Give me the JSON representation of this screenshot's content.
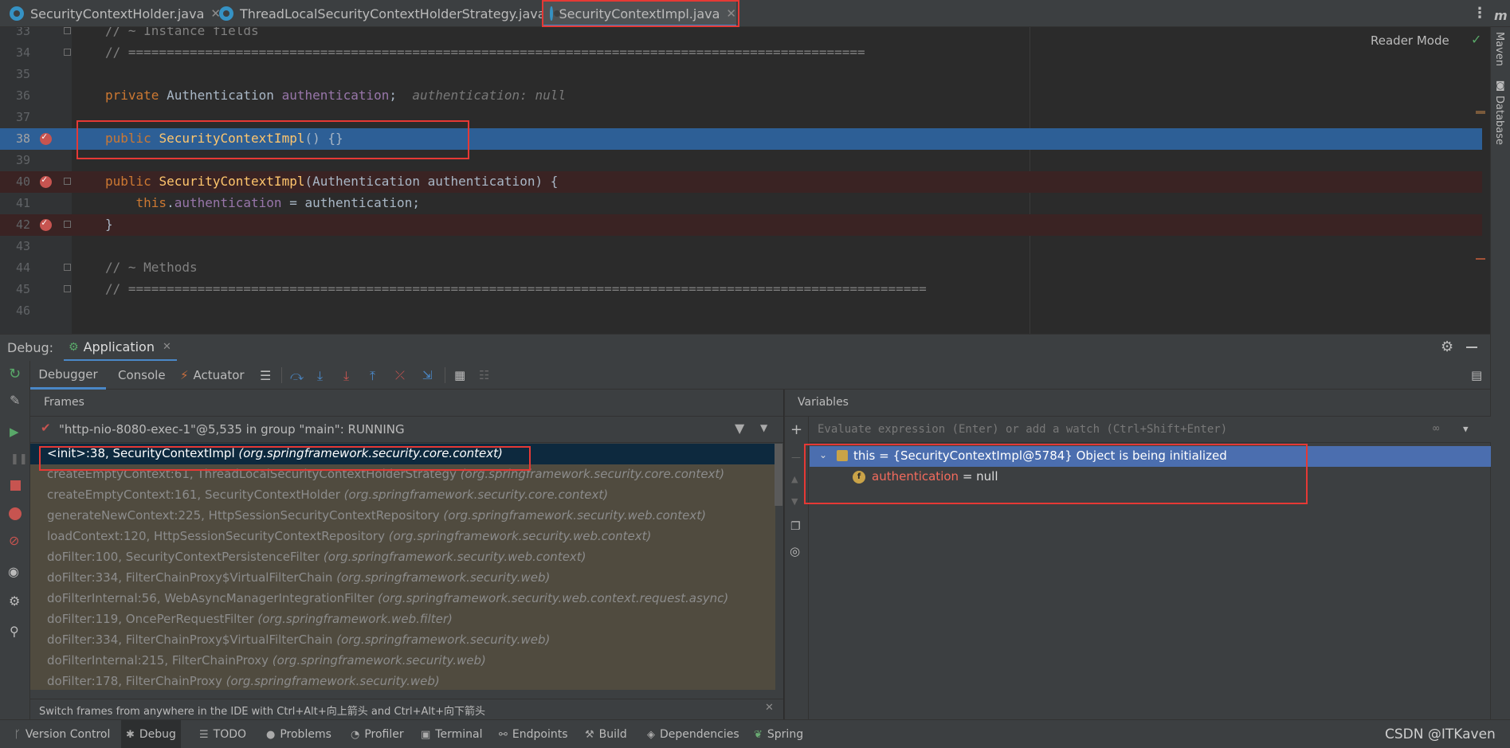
{
  "tabs": [
    {
      "label": "SecurityContextHolder.java"
    },
    {
      "label": "ThreadLocalSecurityContextHolderStrategy.java"
    },
    {
      "label": "SecurityContextImpl.java"
    }
  ],
  "editor": {
    "reader_mode": "Reader Mode",
    "lines": [
      {
        "n": "33",
        "text": "// ~ Instance fields"
      },
      {
        "n": "34",
        "text": "// ================================================================================================"
      },
      {
        "n": "35",
        "text": ""
      },
      {
        "n": "36",
        "kw": "private",
        "type": " Authentication ",
        "field": "authentication",
        "rest": ";",
        "hint": "authentication: null"
      },
      {
        "n": "37",
        "text": ""
      },
      {
        "n": "38",
        "kw": "public",
        "fn": "SecurityContextImpl",
        "rest": "() {}"
      },
      {
        "n": "39",
        "text": ""
      },
      {
        "n": "40",
        "kw": "public",
        "fn": "SecurityContextImpl",
        "rest": "(Authentication authentication) {"
      },
      {
        "n": "41",
        "kw": "this",
        "field": "authentication",
        "rest": " = authentication;"
      },
      {
        "n": "42",
        "text": "}"
      },
      {
        "n": "43",
        "text": ""
      },
      {
        "n": "44",
        "text": "// ~ Methods"
      },
      {
        "n": "45",
        "text": "// ========================================================================================================"
      },
      {
        "n": "46",
        "text": ""
      }
    ]
  },
  "debug": {
    "label": "Debug:",
    "config": "Application",
    "subtabs": [
      "Debugger",
      "Console",
      "Actuator"
    ],
    "frames_title": "Frames",
    "variables_title": "Variables",
    "thread": "\"http-nio-8080-exec-1\"@5,535 in group \"main\": RUNNING",
    "frames": [
      {
        "method": "<init>:38, SecurityContextImpl ",
        "pkg": "(org.springframework.security.core.context)"
      },
      {
        "method": "createEmptyContext:61, ThreadLocalSecurityContextHolderStrategy ",
        "pkg": "(org.springframework.security.core.context)"
      },
      {
        "method": "createEmptyContext:161, SecurityContextHolder ",
        "pkg": "(org.springframework.security.core.context)"
      },
      {
        "method": "generateNewContext:225, HttpSessionSecurityContextRepository ",
        "pkg": "(org.springframework.security.web.context)"
      },
      {
        "method": "loadContext:120, HttpSessionSecurityContextRepository ",
        "pkg": "(org.springframework.security.web.context)"
      },
      {
        "method": "doFilter:100, SecurityContextPersistenceFilter ",
        "pkg": "(org.springframework.security.web.context)"
      },
      {
        "method": "doFilter:334, FilterChainProxy$VirtualFilterChain ",
        "pkg": "(org.springframework.security.web)"
      },
      {
        "method": "doFilterInternal:56, WebAsyncManagerIntegrationFilter ",
        "pkg": "(org.springframework.security.web.context.request.async)"
      },
      {
        "method": "doFilter:119, OncePerRequestFilter ",
        "pkg": "(org.springframework.web.filter)"
      },
      {
        "method": "doFilter:334, FilterChainProxy$VirtualFilterChain ",
        "pkg": "(org.springframework.security.web)"
      },
      {
        "method": "doFilterInternal:215, FilterChainProxy ",
        "pkg": "(org.springframework.security.web)"
      },
      {
        "method": "doFilter:178, FilterChainProxy ",
        "pkg": "(org.springframework.security.web)"
      }
    ],
    "hint": "Switch frames from anywhere in the IDE with Ctrl+Alt+向上箭头 and Ctrl+Alt+向下箭头",
    "eval_placeholder": "Evaluate expression (Enter) or add a watch (Ctrl+Shift+Enter)",
    "var_this": "this = {SecurityContextImpl@5784} Object is being initialized",
    "var_field_name": "authentication",
    "var_field_value": " = null"
  },
  "right_tools": [
    "Maven",
    "Database"
  ],
  "statusbar": [
    {
      "label": "Version Control"
    },
    {
      "label": "Debug"
    },
    {
      "label": "TODO"
    },
    {
      "label": "Problems"
    },
    {
      "label": "Profiler"
    },
    {
      "label": "Terminal"
    },
    {
      "label": "Endpoints"
    },
    {
      "label": "Build"
    },
    {
      "label": "Dependencies"
    },
    {
      "label": "Spring"
    }
  ],
  "watermark": "CSDN @ITKaven"
}
